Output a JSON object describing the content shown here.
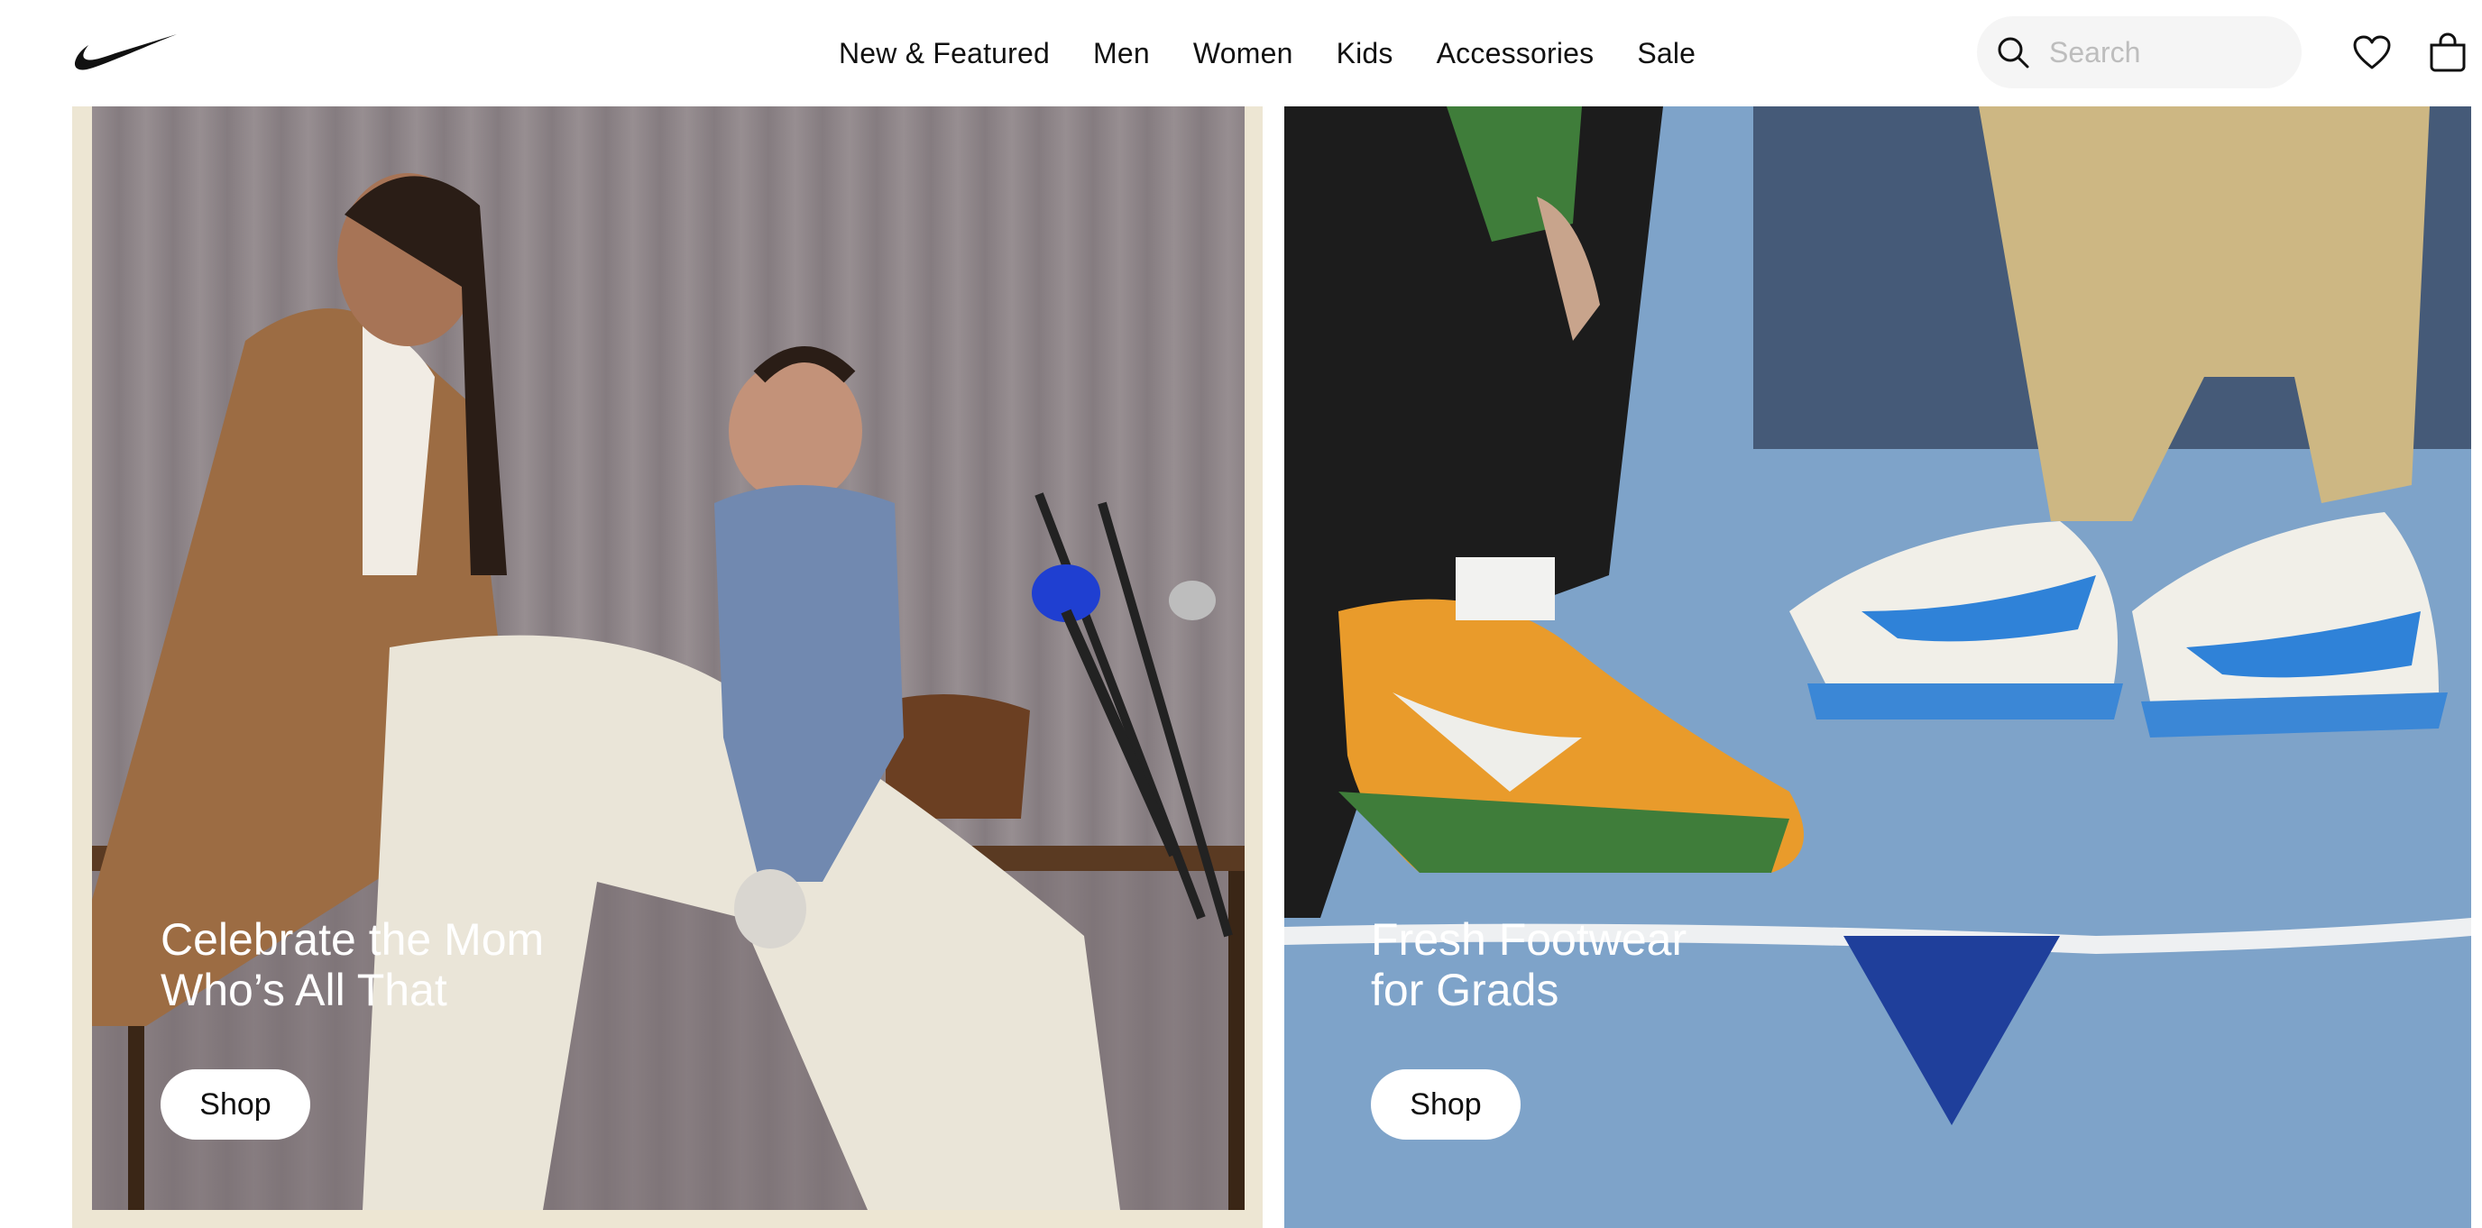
{
  "header": {
    "brand": "Nike",
    "nav": [
      "New & Featured",
      "Men",
      "Women",
      "Kids",
      "Accessories",
      "Sale"
    ],
    "search": {
      "placeholder": "Search",
      "value": ""
    },
    "icons": [
      "search-icon",
      "favorites-icon",
      "bag-icon"
    ]
  },
  "hero": [
    {
      "headline_line1": "Celebrate the Mom",
      "headline_line2": "Who’s All That",
      "button": "Shop"
    },
    {
      "headline_line1": "Fresh Footwear",
      "headline_line2": "for Grads",
      "button": "Shop"
    }
  ],
  "colors": {
    "text": "#111111",
    "background": "#ffffff",
    "search_bg": "#f5f5f5",
    "left_card_border": "#ede6d3",
    "right_card_floor": "#7ea3c9"
  }
}
